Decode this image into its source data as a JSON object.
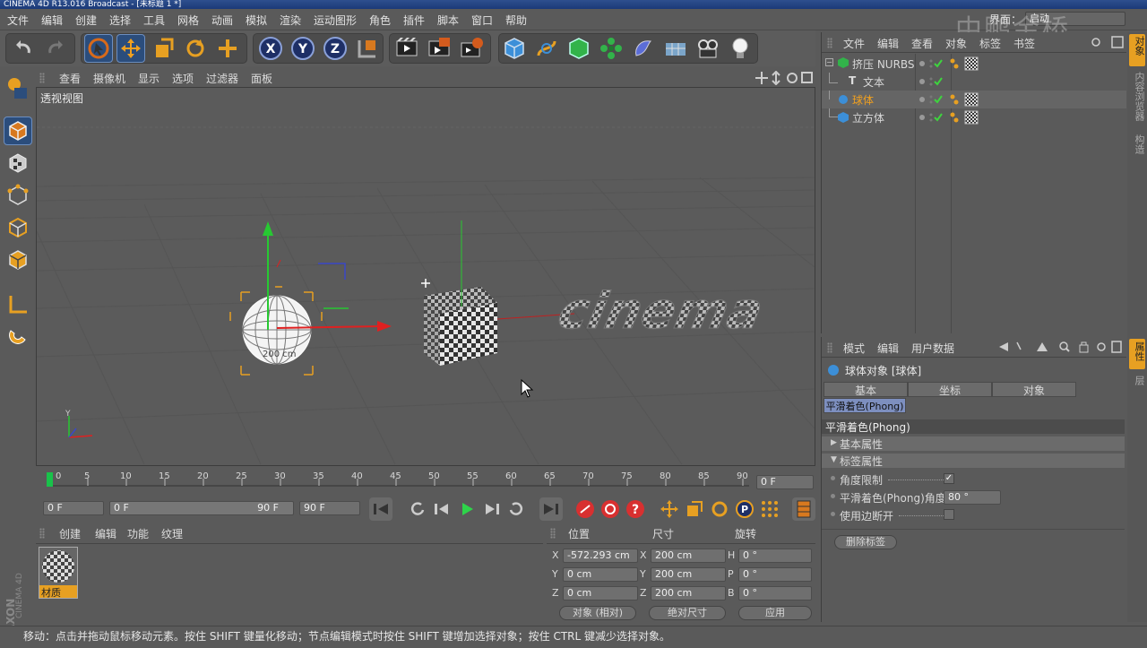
{
  "window": {
    "title": "CINEMA 4D R13.016 Broadcast - [未标题 1 *]"
  },
  "menu": [
    "文件",
    "编辑",
    "创建",
    "选择",
    "工具",
    "网格",
    "动画",
    "模拟",
    "渲染",
    "运动图形",
    "角色",
    "插件",
    "脚本",
    "窗口",
    "帮助"
  ],
  "layout": {
    "label": "界面：",
    "value": "启动"
  },
  "watermark": "中鹏金桥",
  "toolbar": {
    "icons": [
      "undo-icon",
      "redo-icon",
      "select-icon",
      "move-icon",
      "scale-icon",
      "rotate-icon",
      "add-icon",
      "x-axis-icon",
      "y-axis-icon",
      "z-axis-icon",
      "coord-system-icon",
      "render-view-icon",
      "render-picture-icon",
      "render-settings-icon",
      "cube-icon",
      "spline-icon",
      "nurbs-icon",
      "array-icon",
      "deformer-icon",
      "scene-icon",
      "camera-icon",
      "light-icon"
    ],
    "axis_labels": [
      "X",
      "Y",
      "Z"
    ]
  },
  "viewport": {
    "menu": [
      "查看",
      "摄像机",
      "显示",
      "选项",
      "过滤器",
      "面板"
    ],
    "label": "透视视图",
    "sphere_label": "200 cm",
    "text3d": "cinema"
  },
  "timeline": {
    "ticks": [
      "0",
      "5",
      "10",
      "15",
      "20",
      "25",
      "30",
      "35",
      "40",
      "45",
      "50",
      "55",
      "60",
      "65",
      "70",
      "75",
      "80",
      "85",
      "90"
    ],
    "current_frame": "0 F"
  },
  "transport": {
    "start": "0 F",
    "range_start": "0 F",
    "range_end": "90 F",
    "end": "90 F"
  },
  "material_manager": {
    "menu": [
      "创建",
      "编辑",
      "功能",
      "纹理"
    ],
    "material_name": "材质"
  },
  "coordinates": {
    "headers": [
      "位置",
      "尺寸",
      "旋转"
    ],
    "rows": [
      {
        "axis": "X",
        "pos": "-572.293 cm",
        "size_axis": "X",
        "size": "200 cm",
        "rot_axis": "H",
        "rot": "0 °"
      },
      {
        "axis": "Y",
        "pos": "0 cm",
        "size_axis": "Y",
        "size": "200 cm",
        "rot_axis": "P",
        "rot": "0 °"
      },
      {
        "axis": "Z",
        "pos": "0 cm",
        "size_axis": "Z",
        "size": "200 cm",
        "rot_axis": "B",
        "rot": "0 °"
      }
    ],
    "mode": "对象 (相对)",
    "size_mode": "绝对尺寸",
    "apply": "应用"
  },
  "object_manager": {
    "menu": [
      "文件",
      "编辑",
      "查看",
      "对象",
      "标签",
      "书签"
    ],
    "objects": [
      {
        "name": "挤压 NURBS",
        "indent": 0,
        "selected": false
      },
      {
        "name": "文本",
        "indent": 1,
        "selected": false
      },
      {
        "name": "球体",
        "indent": 0,
        "selected": true
      },
      {
        "name": "立方体",
        "indent": 0,
        "selected": false
      }
    ]
  },
  "attribute_manager": {
    "menu": [
      "模式",
      "编辑",
      "用户数据"
    ],
    "object_title": "球体对象 [球体]",
    "tabs": [
      "基本",
      "坐标",
      "对象"
    ],
    "active_tab": "平滑着色(Phong)",
    "section_title": "平滑着色(Phong)",
    "groups": [
      "基本属性",
      "标签属性"
    ],
    "props": [
      {
        "label": "角度限制",
        "type": "checkbox",
        "value": "✓"
      },
      {
        "label": "平滑着色(Phong)角度",
        "type": "number",
        "value": "80 °"
      },
      {
        "label": "使用边断开",
        "type": "checkbox",
        "value": ""
      }
    ],
    "delete_button": "删除标签"
  },
  "right_tabs": [
    "对象",
    "内容浏览器",
    "构造"
  ],
  "attr_side_tabs": [
    "属性",
    "层"
  ],
  "maxon_logo": "MAXON CINEMA 4D",
  "status": "移动：点击并拖动鼠标移动元素。按住 SHIFT 键量化移动；节点编辑模式时按住 SHIFT 键增加选择对象；按住 CTRL 键减少选择对象。"
}
